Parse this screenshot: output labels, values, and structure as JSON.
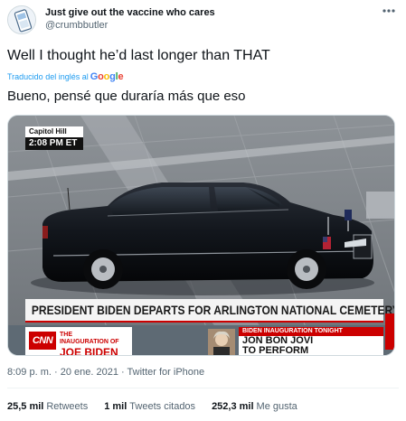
{
  "tweet": {
    "display_name": "Just give out the vaccine who cares",
    "handle": "@crumbbutler",
    "more_icon": "more-horizontal-icon",
    "text": "Well I thought he’d last longer than THAT",
    "translate_label": "Traducido del inglés al",
    "translator_brand": "Google",
    "translated_text": "Bueno, pensé que duraría más que eso",
    "meta": {
      "time": "8:09 p. m.",
      "separator": "·",
      "date": "20 ene. 2021",
      "source": "Twitter for iPhone"
    },
    "stats": [
      {
        "count": "25,5 mil",
        "label": "Retweets"
      },
      {
        "count": "1 mil",
        "label": "Tweets citados"
      },
      {
        "count": "252,3 mil",
        "label": "Me gusta"
      }
    ]
  },
  "media": {
    "bug_location": "Capitol Hill",
    "bug_time": "2:08 PM ET",
    "lower_third": "PRESIDENT BIDEN DEPARTS FOR ARLINGTON NATIONAL CEMETERY",
    "network_logo": "CNN",
    "program_line1": "THE",
    "program_line1b": "INAUGURATION OF",
    "program_line2": "JOE BIDEN",
    "story_kicker": "BIDEN INAUGURATION TONIGHT",
    "story_head1": "JON BON JOVI",
    "story_head2": "TO PERFORM"
  }
}
